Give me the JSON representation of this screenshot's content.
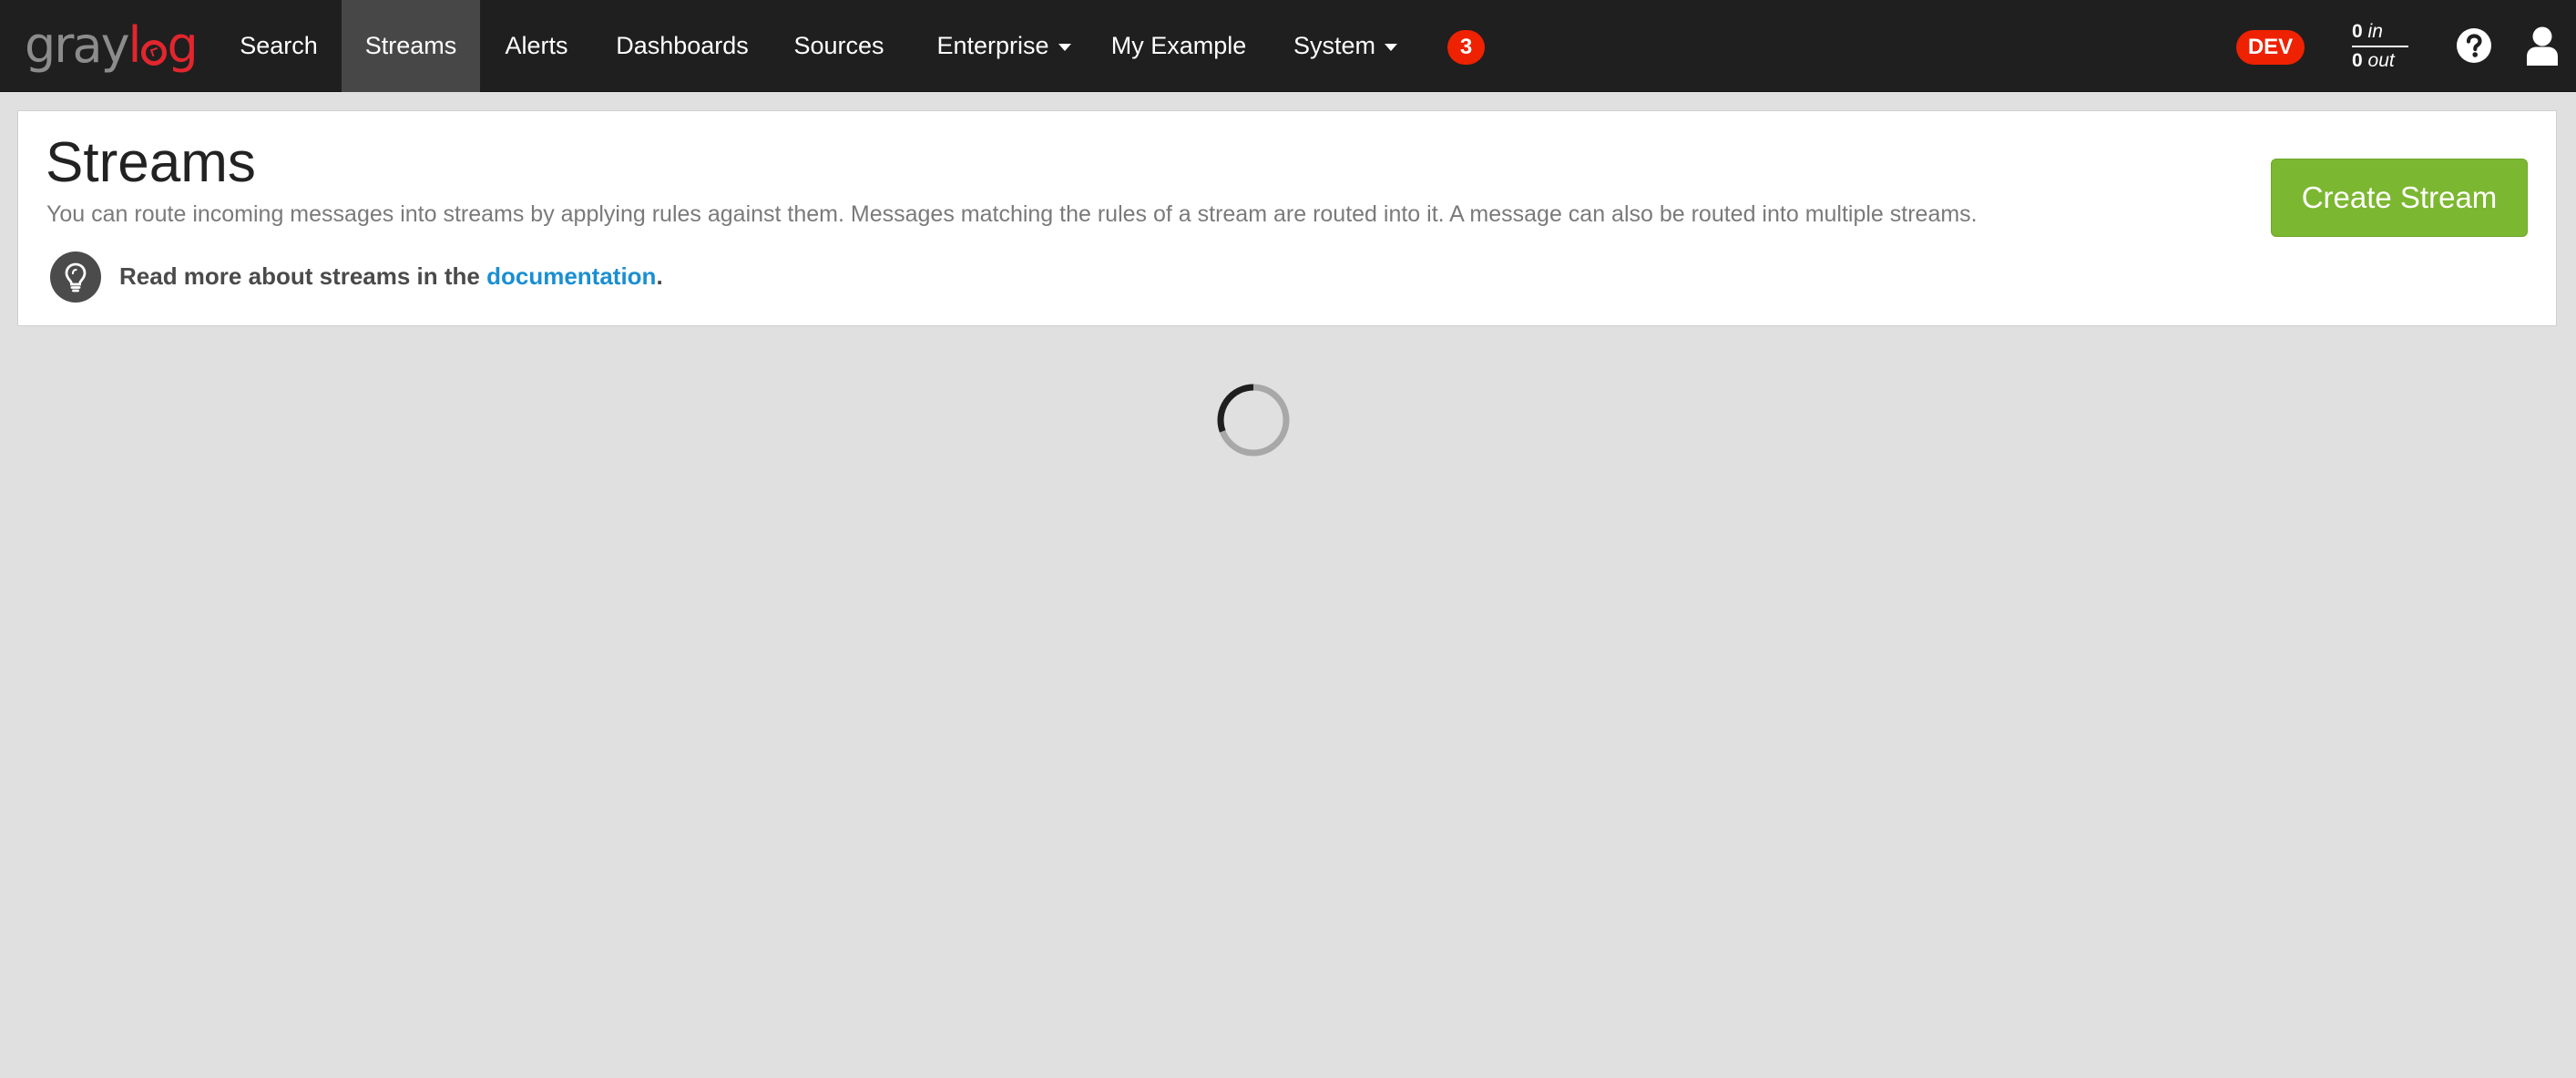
{
  "brand": {
    "name_gray": "gray",
    "name_red": "log"
  },
  "nav": {
    "items": [
      {
        "label": "Search"
      },
      {
        "label": "Streams",
        "active": true
      },
      {
        "label": "Alerts"
      },
      {
        "label": "Dashboards"
      },
      {
        "label": "Sources"
      },
      {
        "label": "Enterprise",
        "dropdown": true
      },
      {
        "label": "My Example"
      },
      {
        "label": "System",
        "dropdown": true
      }
    ],
    "notification_count": "3",
    "environment_badge": "DEV",
    "throughput": {
      "in_value": "0",
      "in_label": "in",
      "out_value": "0",
      "out_label": "out"
    },
    "icons": [
      "help-icon",
      "user-icon"
    ]
  },
  "header": {
    "title": "Streams",
    "description": "You can route incoming messages into streams by applying rules against them. Messages matching the rules of a stream are routed into it. A message can also be routed into multiple streams.",
    "hint_prefix": "Read more about streams in the ",
    "hint_link": "documentation",
    "hint_suffix": ".",
    "create_button": "Create Stream"
  },
  "colors": {
    "navbar_bg": "#1f1f1f",
    "active_nav_bg": "#474747",
    "brand_red": "#e2262e",
    "badge_red": "#ee2200",
    "primary_green": "#7cb731",
    "link_blue": "#1a8fd2",
    "page_bg": "#e0e0e0"
  },
  "loading": true
}
